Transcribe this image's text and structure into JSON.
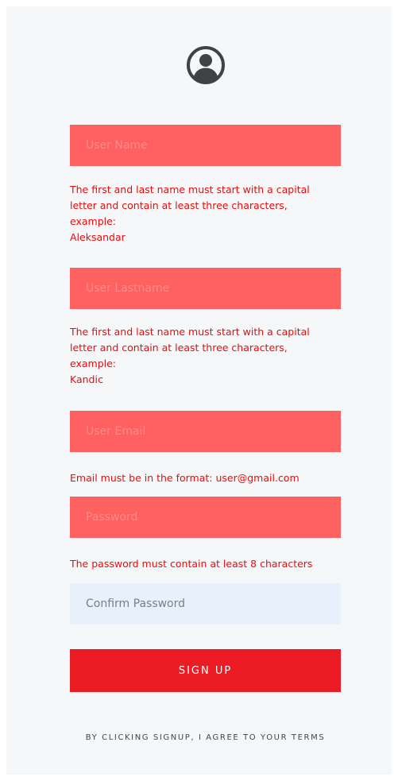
{
  "form": {
    "avatar_icon": "user-circle-icon",
    "fields": {
      "user_name": {
        "placeholder": "User Name",
        "value": ""
      },
      "user_lastname": {
        "placeholder": "User Lastname",
        "value": ""
      },
      "user_email": {
        "placeholder": "User Email",
        "value": ""
      },
      "password": {
        "placeholder": "Password",
        "value": ""
      },
      "confirm_password": {
        "placeholder": "Confirm Password",
        "value": ""
      }
    },
    "errors": {
      "name": "The first and last name must start with a capital\nletter and contain at least three characters,\nexample:\nAleksandar",
      "lastname": "The first and last name must start with a capital\nletter and contain at least three characters,\nexample:\nKandic",
      "email": "Email must be in the format: user@gmail.com",
      "password": "The password must contain at least 8 characters"
    },
    "signup_label": "SIGN UP",
    "terms_text": "BY CLICKING SIGNUP, I AGREE TO YOUR TERMS"
  },
  "colors": {
    "invalid_field": "#ff6060",
    "error_text": "#ee0a0a",
    "signup_button": "#ec1c24",
    "confirm_field": "#e8f0fb",
    "panel_bg": "#f6f7f9"
  }
}
